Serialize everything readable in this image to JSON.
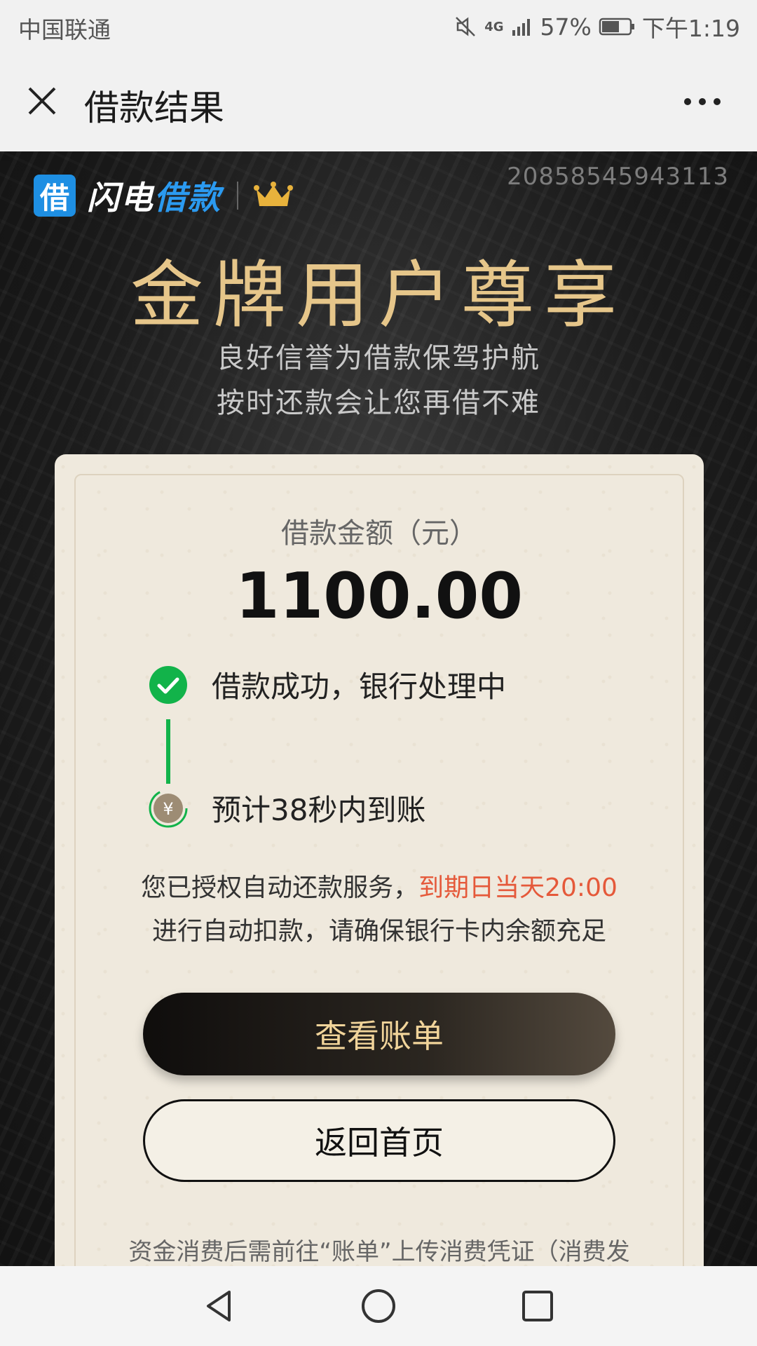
{
  "status_bar": {
    "carrier": "中国联通",
    "network": "4G",
    "battery": "57%",
    "time": "下午1:19"
  },
  "titlebar": {
    "title": "借款结果",
    "close_icon": "close-icon",
    "more_icon": "more-icon"
  },
  "hero": {
    "order_id": "20858545943113",
    "brand_logo_char": "借",
    "brand_name_white": "闪电",
    "brand_name_blue": "借款",
    "title": "金牌用户尊享",
    "subtitle_line1": "良好信誉为借款保驾护航",
    "subtitle_line2": "按时还款会让您再借不难"
  },
  "card": {
    "amount_label": "借款金额（元）",
    "amount": "1100.00",
    "steps": [
      {
        "label": "借款成功，银行处理中",
        "icon": "check-circle-icon"
      },
      {
        "label": "预计38秒内到账",
        "icon": "yuan-coin-icon"
      }
    ],
    "notice_prefix": "您已授权自动还款服务，",
    "notice_highlight": "到期日当天20:00",
    "notice_suffix": "进行自动扣款，请确保银行卡内余额充足",
    "primary_button": "查看账单",
    "secondary_button": "返回首页",
    "foot_note": "资金消费后需前往“账单”上传消费凭证（消费发"
  },
  "colors": {
    "accent_gold": "#e6c68a",
    "success_green": "#12b34a",
    "highlight_red": "#e5593a",
    "brand_blue": "#1e8fe3"
  }
}
